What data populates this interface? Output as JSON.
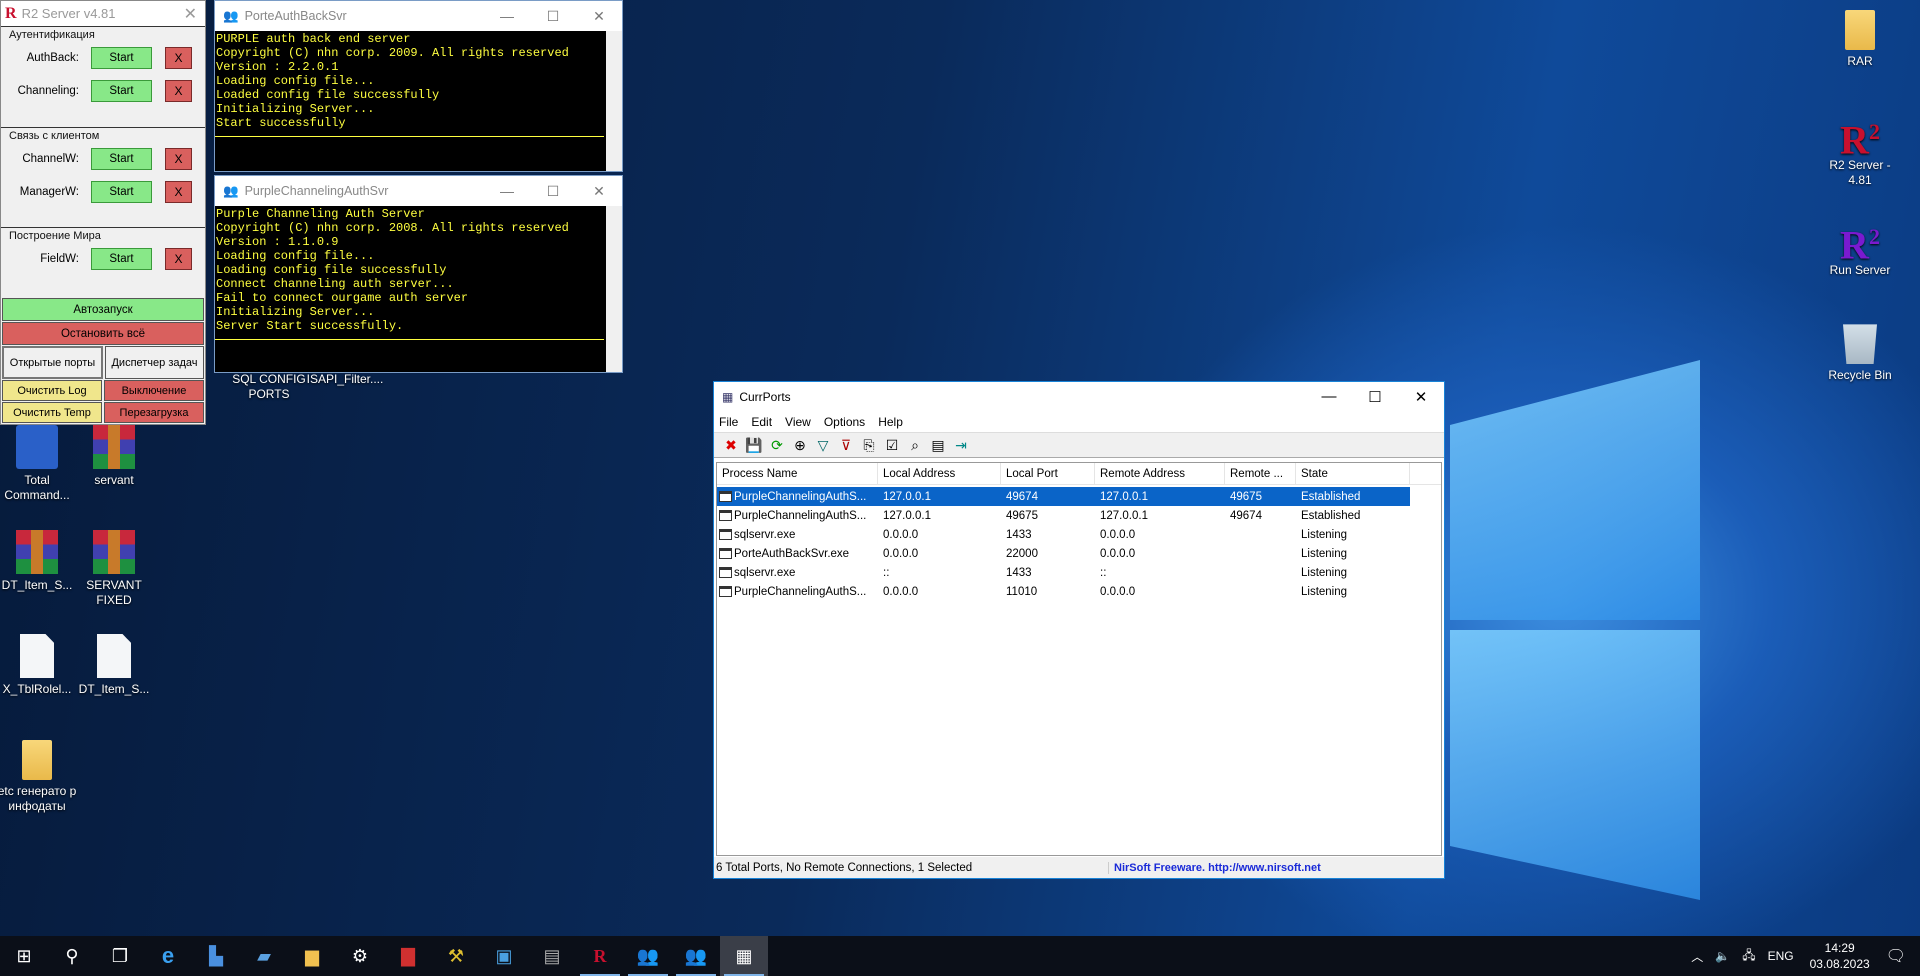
{
  "desktop": {
    "left_icons": [
      {
        "label": "Total Command...",
        "icon": "total-commander-icon"
      },
      {
        "label": "servant",
        "icon": "winrar-archive-icon"
      },
      {
        "label": "DT_Item_S...",
        "icon": "winrar-archive-icon"
      },
      {
        "label": "SERVANT FIXED",
        "icon": "winrar-archive-icon"
      },
      {
        "label": "X_TblRolel...",
        "icon": "file-icon"
      },
      {
        "label": "DT_Item_S...",
        "icon": "file-icon"
      },
      {
        "label": "etc генерато р инфодаты",
        "icon": "folder-icon"
      }
    ],
    "right_icons": [
      {
        "label": "RAR",
        "icon": "folder-icon"
      },
      {
        "label": "R2 Server - 4.81",
        "icon": "r2-red-icon"
      },
      {
        "label": "Run Server",
        "icon": "r2-purple-icon"
      },
      {
        "label": "Recycle Bin",
        "icon": "recycle-bin-icon"
      }
    ],
    "partial_labels": [
      "SQL CONFIG",
      "ISAPI_Filter....",
      "PORTS"
    ]
  },
  "r2": {
    "title": "R2 Server v4.81",
    "groups": [
      {
        "label": "Аутентификация",
        "rows": [
          {
            "label": "AuthBack:"
          },
          {
            "label": "Channeling:"
          }
        ]
      },
      {
        "label": "Связь с клиентом",
        "rows": [
          {
            "label": "ChannelW:"
          },
          {
            "label": "ManagerW:"
          }
        ]
      },
      {
        "label": "Построение Мира",
        "rows": [
          {
            "label": "FieldW:"
          }
        ]
      }
    ],
    "start": "Start",
    "stop": "X",
    "autostart": "Автозапуск",
    "stop_all": "Остановить всё",
    "open_ports": "Открытые порты",
    "task_manager": "Диспетчер задач",
    "clear_log": "Очистить Log",
    "shutdown": "Выключение",
    "clear_temp": "Очистить Temp",
    "reboot": "Перезагрузка"
  },
  "console1": {
    "title": "PorteAuthBackSvr",
    "text": "PURPLE auth back end server\nCopyright (C) nhn corp. 2009. All rights reserved\nVersion : 2.2.0.1\nLoading config file...\nLoaded config file successfully\nInitializing Server...\nStart successfully"
  },
  "console2": {
    "title": "PurpleChannelingAuthSvr",
    "text": "Purple Channeling Auth Server\nCopyright (C) nhn corp. 2008. All rights reserved\nVersion : 1.1.0.9\nLoading config file...\nLoading config file successfully\nConnect channeling auth server...\nFail to connect ourgame auth server\nInitializing Server...\nServer Start successfully."
  },
  "currports": {
    "title": "CurrPorts",
    "menu": [
      "File",
      "Edit",
      "View",
      "Options",
      "Help"
    ],
    "columns": [
      "Process Name",
      "Local Address",
      "Local Port",
      "Remote Address",
      "Remote ...",
      "State"
    ],
    "rows": [
      [
        "PurpleChannelingAuthS...",
        "127.0.0.1",
        "49674",
        "127.0.0.1",
        "49675",
        "Established"
      ],
      [
        "PurpleChannelingAuthS...",
        "127.0.0.1",
        "49675",
        "127.0.0.1",
        "49674",
        "Established"
      ],
      [
        "sqlservr.exe",
        "0.0.0.0",
        "1433",
        "0.0.0.0",
        "",
        "Listening"
      ],
      [
        "PorteAuthBackSvr.exe",
        "0.0.0.0",
        "22000",
        "0.0.0.0",
        "",
        "Listening"
      ],
      [
        "sqlservr.exe",
        "::",
        "1433",
        "::",
        "",
        "Listening"
      ],
      [
        "PurpleChannelingAuthS...",
        "0.0.0.0",
        "11010",
        "0.0.0.0",
        "",
        "Listening"
      ]
    ],
    "selected_row": 0,
    "status_left": "6 Total Ports, No Remote Connections, 1 Selected",
    "status_right": "NirSoft Freeware.  http://www.nirsoft.net"
  },
  "taskbar": {
    "time": "14:29",
    "date": "03.08.2023",
    "lang": "ENG"
  },
  "colors": {
    "accent": "#0a64c8",
    "console_text": "#ffff40",
    "start_green": "#88e888",
    "stop_red": "#d9605e",
    "clear_yellow": "#f0e68c"
  }
}
